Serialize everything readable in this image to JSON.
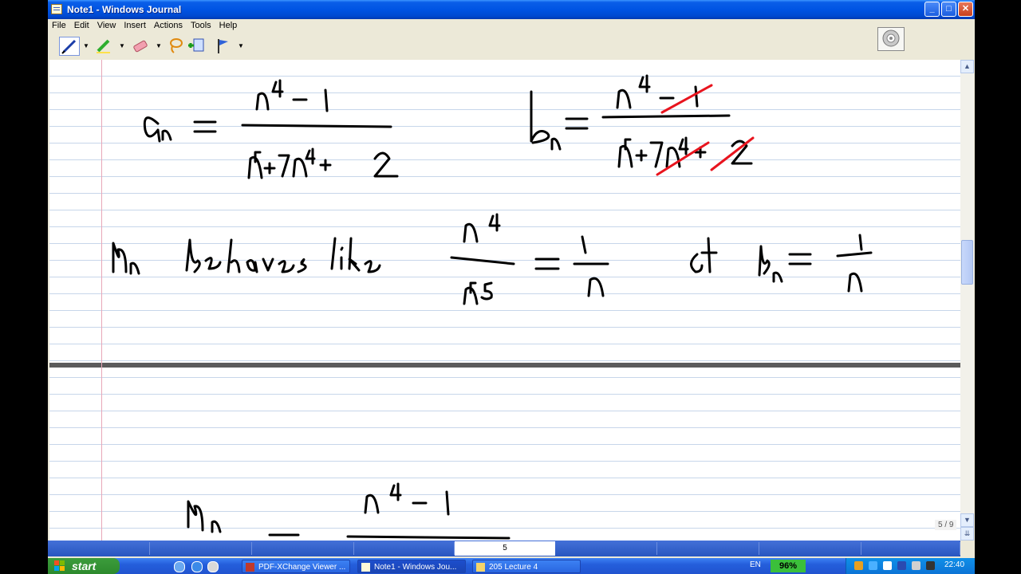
{
  "window": {
    "title": "Note1 - Windows Journal",
    "buttons": {
      "minimize": "_",
      "maximize": "□",
      "close": "✕"
    }
  },
  "menubar": {
    "items": [
      "File",
      "Edit",
      "View",
      "Insert",
      "Actions",
      "Tools",
      "Help"
    ]
  },
  "toolbar": {
    "tools": [
      {
        "name": "pen-tool",
        "icon": "pen-icon"
      },
      {
        "name": "highlighter-tool",
        "icon": "highlighter-icon"
      },
      {
        "name": "eraser-tool",
        "icon": "eraser-icon"
      },
      {
        "name": "lasso-select-tool",
        "icon": "lasso-icon"
      },
      {
        "name": "insert-space-tool",
        "icon": "insert-space-icon"
      },
      {
        "name": "flag-tool",
        "icon": "flag-icon"
      }
    ],
    "disc_button_icon": "cd-icon"
  },
  "note": {
    "page_indicator": "5 / 9",
    "ink_color": "#000000",
    "correction_color": "#e8141e",
    "handwriting": {
      "line1_left": "a_n = (n^4 - 1) / (n^5 + 7n^4 + 2)",
      "line1_right": "b_n = (n^4 - 1) / (n^5 + 7n^4 + 2)",
      "line2": "a_n behaves like n^4 / n^5 = 1/n   let b_n = 1/n",
      "line3": "a_n = (n^4 - 1) / ..."
    }
  },
  "page_nav": {
    "current_page": "5"
  },
  "taskbar": {
    "start_label": "start",
    "tasks": [
      {
        "label": "PDF-XChange Viewer ...",
        "active": false
      },
      {
        "label": "Note1 - Windows Jou...",
        "active": true
      },
      {
        "label": "205 Lecture 4",
        "active": false
      }
    ],
    "language": "EN",
    "battery": "96%",
    "clock": "22:40"
  }
}
